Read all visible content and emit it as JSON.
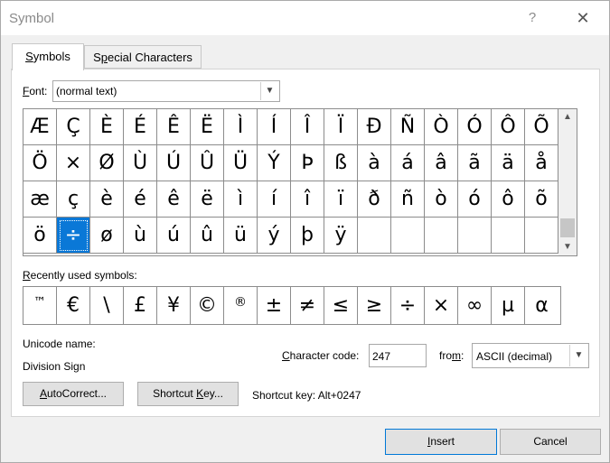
{
  "window": {
    "title": "Symbol",
    "help": "?",
    "close": "✕"
  },
  "tabs": [
    {
      "label_u": "S",
      "label_rest": "ymbols"
    },
    {
      "label_pre": "S",
      "label_u": "p",
      "label_rest": "ecial Characters"
    }
  ],
  "font": {
    "label_u": "F",
    "label_rest": "ont:",
    "value": "(normal text)",
    "dropdown_icon": "▼"
  },
  "grid": {
    "selected_index": 49,
    "symbols": [
      "Æ",
      "Ç",
      "È",
      "É",
      "Ê",
      "Ë",
      "Ì",
      "Í",
      "Î",
      "Ï",
      "Ð",
      "Ñ",
      "Ò",
      "Ó",
      "Ô",
      "Õ",
      "Ö",
      "×",
      "Ø",
      "Ù",
      "Ú",
      "Û",
      "Ü",
      "Ý",
      "Þ",
      "ß",
      "à",
      "á",
      "â",
      "ã",
      "ä",
      "å",
      "æ",
      "ç",
      "è",
      "é",
      "ê",
      "ë",
      "ì",
      "í",
      "î",
      "ï",
      "ð",
      "ñ",
      "ò",
      "ó",
      "ô",
      "õ",
      "ö",
      "÷",
      "ø",
      "ù",
      "ú",
      "û",
      "ü",
      "ý",
      "þ",
      "ÿ",
      "",
      "",
      "",
      "",
      "",
      ""
    ],
    "scroll_up": "▲",
    "scroll_down": "▼"
  },
  "recent": {
    "label_u": "R",
    "label_rest": "ecently used symbols:",
    "symbols": [
      "™",
      "€",
      "\\",
      "£",
      "¥",
      "©",
      "®",
      "±",
      "≠",
      "≤",
      "≥",
      "÷",
      "×",
      "∞",
      "µ",
      "α"
    ]
  },
  "unicode": {
    "label": "Unicode name:",
    "value": "Division Sign"
  },
  "char_code": {
    "label_u": "C",
    "label_rest": "haracter code:",
    "value": "247"
  },
  "from": {
    "label_pre": "fro",
    "label_u": "m",
    "label_rest": ":",
    "value": "ASCII (decimal)",
    "dropdown_icon": "▼"
  },
  "buttons": {
    "autocorrect_u": "A",
    "autocorrect_rest": "utoCorrect...",
    "shortcut_pre": "Shortcut ",
    "shortcut_u": "K",
    "shortcut_rest": "ey...",
    "insert_u": "I",
    "insert_rest": "nsert",
    "cancel": "Cancel"
  },
  "shortcut_key": "Shortcut key: Alt+0247"
}
